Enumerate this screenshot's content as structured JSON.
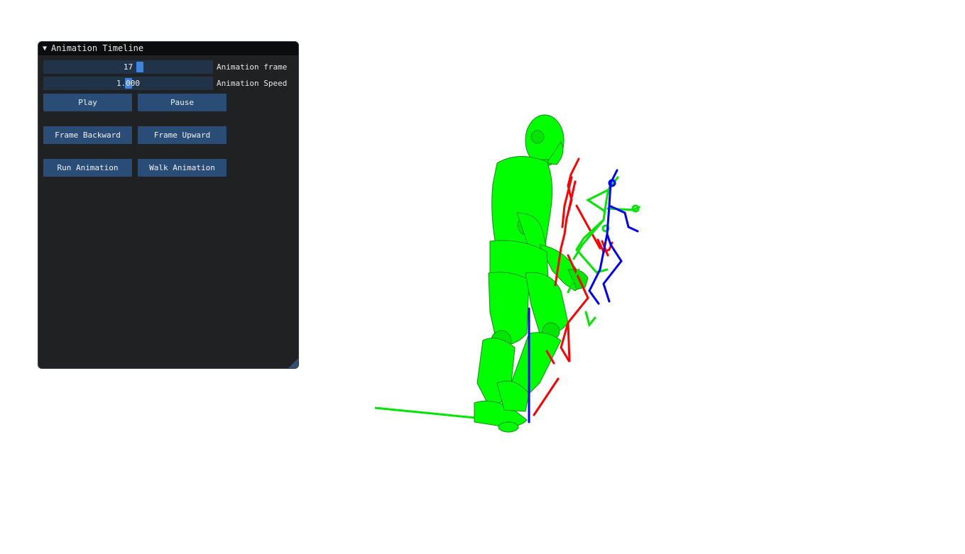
{
  "panel": {
    "title": "Animation Timeline",
    "collapse_icon": "triangle-down-icon",
    "frame_slider": {
      "value": "17",
      "label": "Animation frame",
      "fraction": 0.57
    },
    "speed_slider": {
      "value": "1.000",
      "label": "Animation Speed",
      "fraction": 0.5
    },
    "buttons": {
      "play": "Play",
      "pause": "Pause",
      "frame_backward": "Frame Backward",
      "frame_upward": "Frame Upward",
      "run_animation": "Run Animation",
      "walk_animation": "Walk Animation"
    }
  },
  "colors": {
    "panel_bg": "#1c1d1f",
    "title_bg": "#0b0c0e",
    "button": "#2a4d78",
    "slider_track": "#203349",
    "slider_grab": "#3d85e0",
    "mesh": "#00ff00",
    "skeleton_red": "#ff0000",
    "skeleton_green": "#00e600",
    "skeleton_blue": "#0000ff"
  }
}
